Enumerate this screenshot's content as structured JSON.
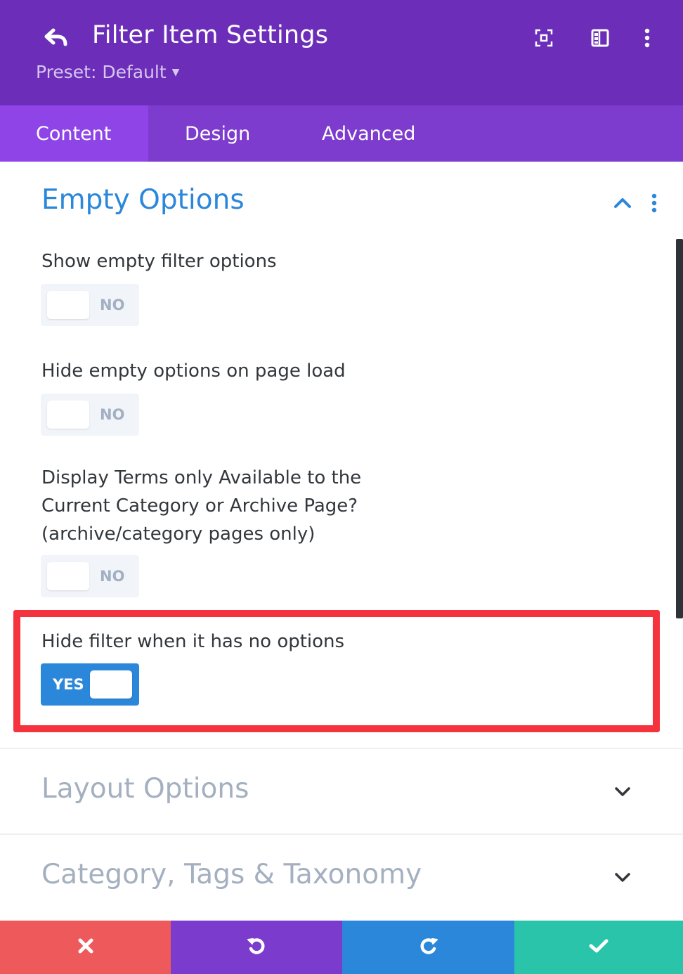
{
  "header": {
    "title": "Filter Item Settings",
    "preset_label": "Preset: Default",
    "icons": [
      "back-arrow-icon",
      "focus-mode-icon",
      "sidebar-layout-icon",
      "more-options-icon"
    ],
    "background_color": "#6c2eb9"
  },
  "tabs": [
    {
      "label": "Content",
      "active": true
    },
    {
      "label": "Design",
      "active": false
    },
    {
      "label": "Advanced",
      "active": false
    }
  ],
  "section": {
    "title": "Empty Options",
    "expanded": true,
    "accent_color": "#2b87da"
  },
  "fields": [
    {
      "label": "Show empty filter options",
      "value": "NO",
      "on": false
    },
    {
      "label": "Hide empty options on page load",
      "value": "NO",
      "on": false
    },
    {
      "label_lines": [
        "Display Terms only Available to the",
        "Current Category or Archive Page?",
        "(archive/category pages only)"
      ],
      "value": "NO",
      "on": false
    },
    {
      "label": "Hide filter when it has no options",
      "value": "YES",
      "on": true,
      "highlighted": true
    }
  ],
  "collapsed_sections": [
    {
      "title": "Layout Options"
    },
    {
      "title": "Category, Tags & Taxonomy"
    }
  ],
  "footer": {
    "buttons": [
      {
        "name": "discard",
        "icon": "close-icon",
        "color": "#ee5a5c"
      },
      {
        "name": "undo",
        "icon": "undo-icon",
        "color": "#7b3cce"
      },
      {
        "name": "redo",
        "icon": "redo-icon",
        "color": "#2b87da"
      },
      {
        "name": "save",
        "icon": "check-icon",
        "color": "#29c4a9"
      }
    ]
  },
  "colors": {
    "highlight_border": "#f5333f",
    "toggle_on": "#2b87da",
    "toggle_off": "#f1f5f9"
  }
}
